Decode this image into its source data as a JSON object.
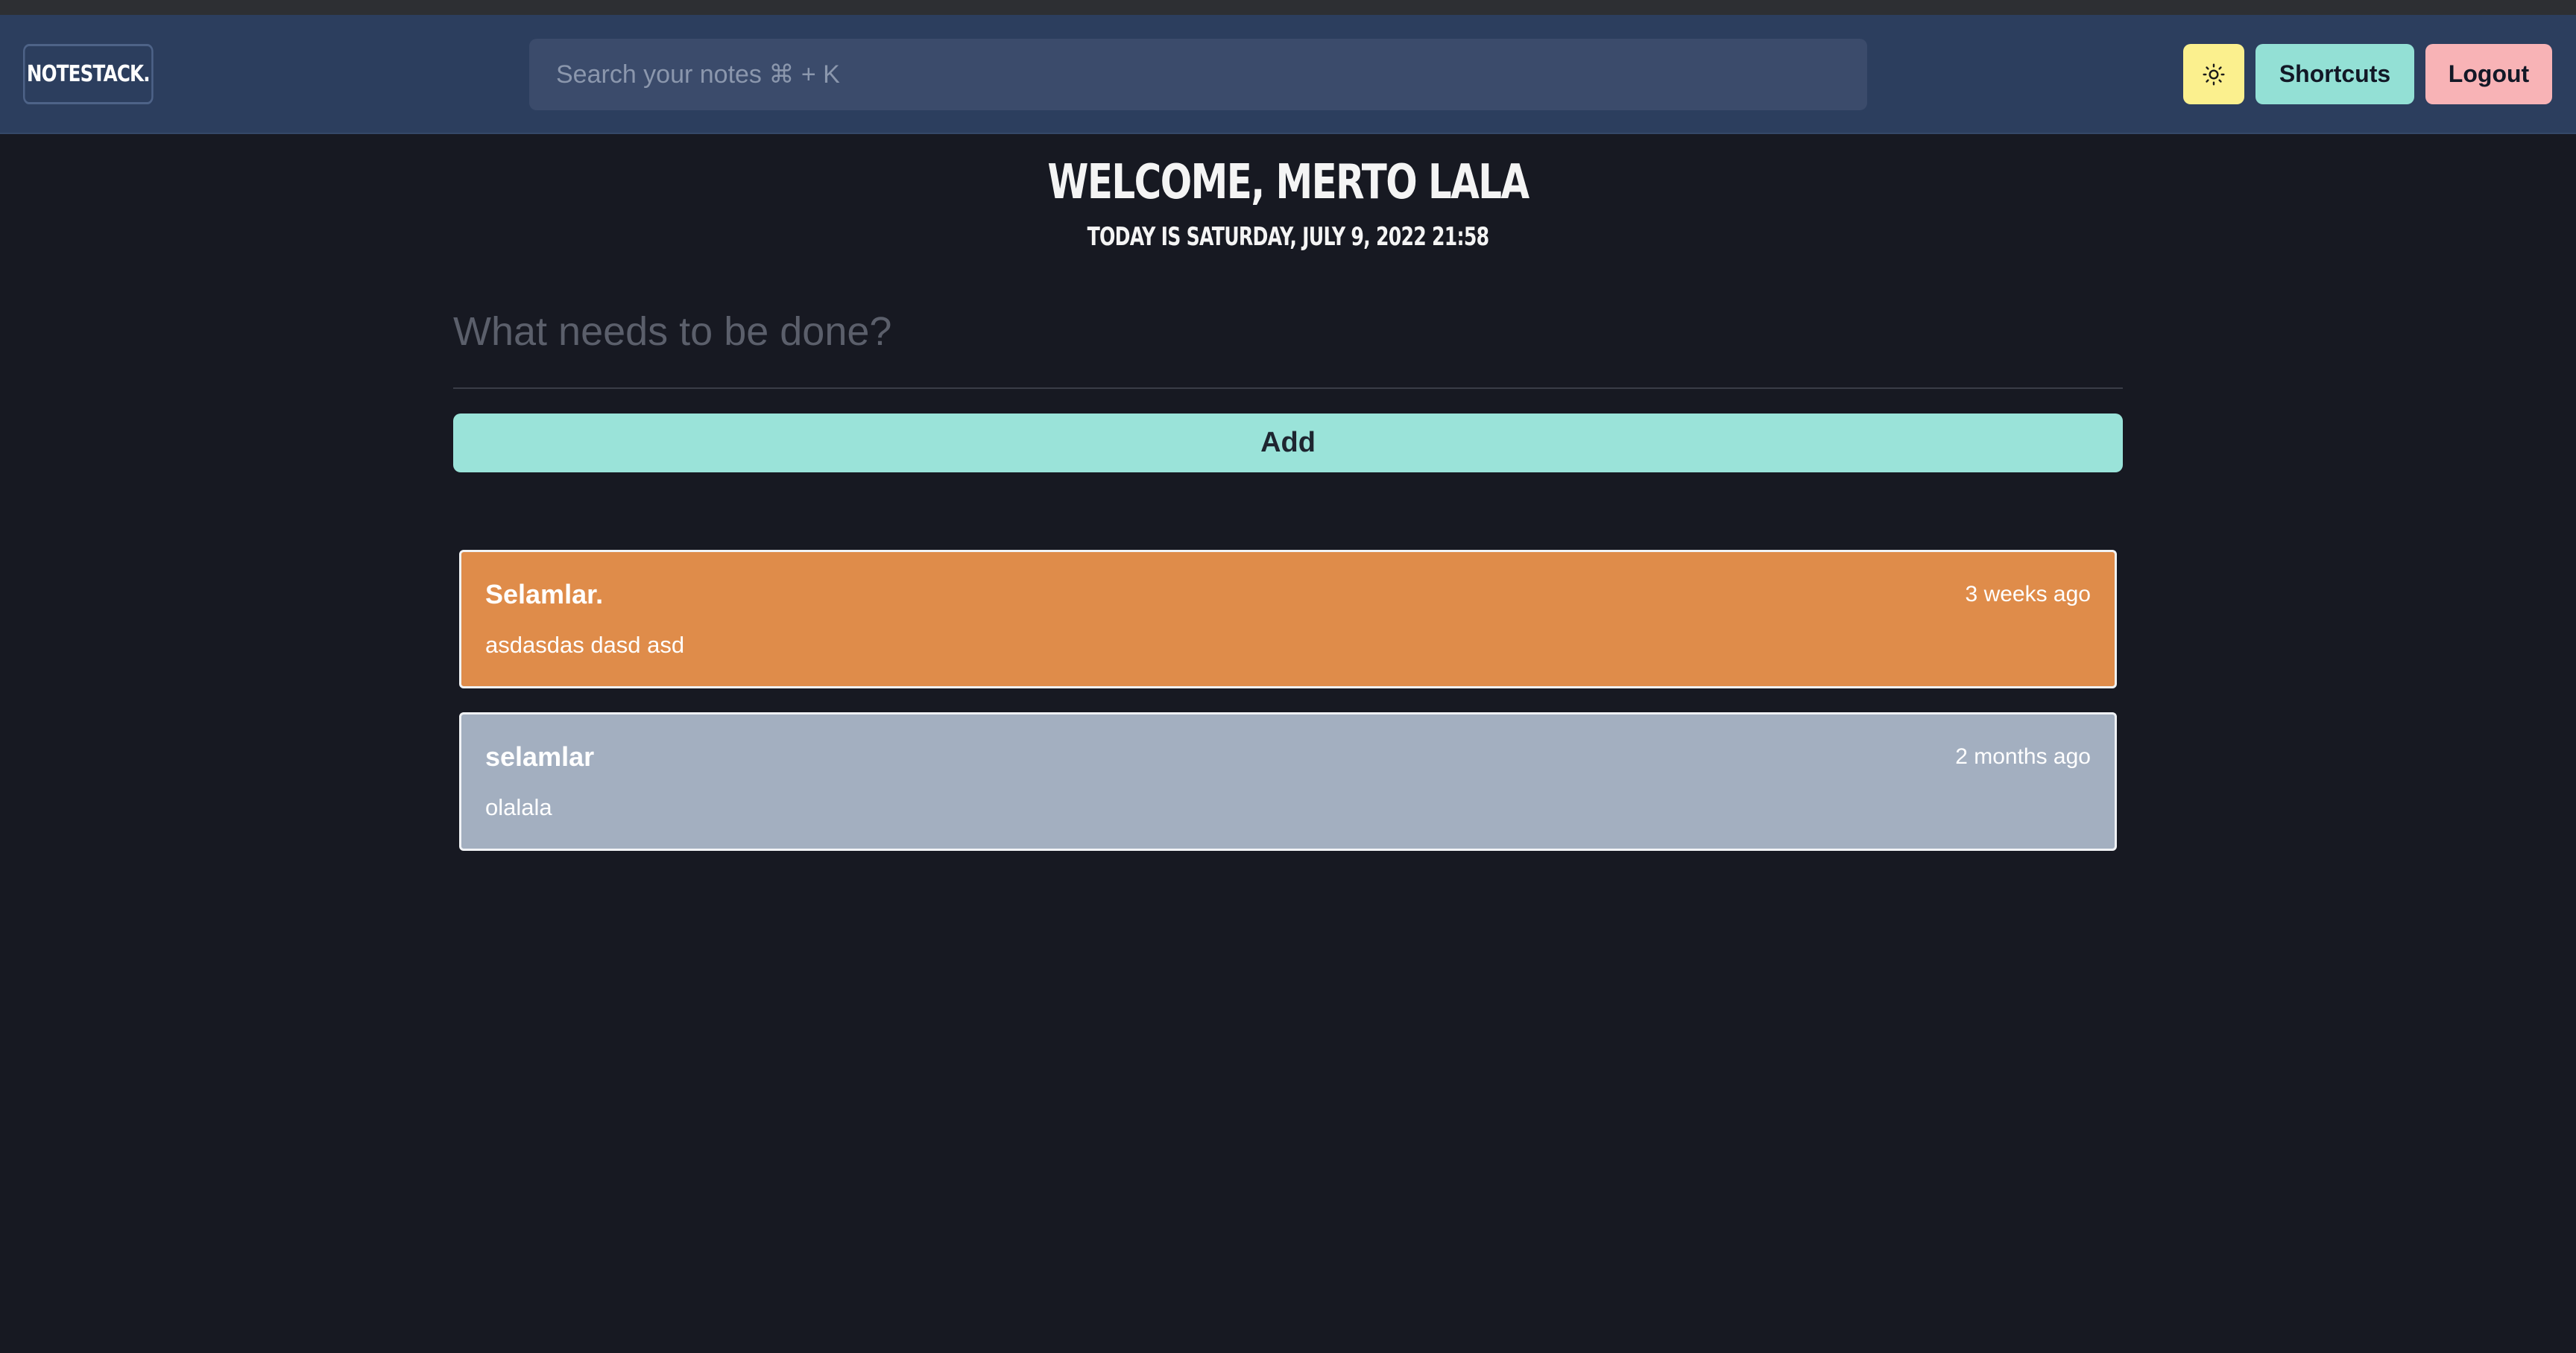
{
  "header": {
    "brand": "NOTESTACK.",
    "search_placeholder": "Search your notes ⌘ + K",
    "theme_icon": "sun-icon",
    "shortcuts_label": "Shortcuts",
    "logout_label": "Logout"
  },
  "main": {
    "welcome": "WELCOME, MERTO LALA",
    "today": "TODAY IS SATURDAY, JULY 9, 2022 21:58",
    "input_placeholder": "What needs to be done?",
    "add_label": "Add"
  },
  "notes": [
    {
      "title": "Selamlar.",
      "time": "3 weeks ago",
      "body": "asdasdas dasd asd",
      "color": "#df8c4a"
    },
    {
      "title": "selamlar",
      "time": "2 months ago",
      "body": "olalala",
      "color": "#a3afc0"
    }
  ],
  "colors": {
    "background": "#171922",
    "navbar": "#2c3e5e",
    "accent_teal": "#9ae3d9",
    "theme_button": "#fbf08e",
    "logout_button": "#f8b3b6"
  }
}
